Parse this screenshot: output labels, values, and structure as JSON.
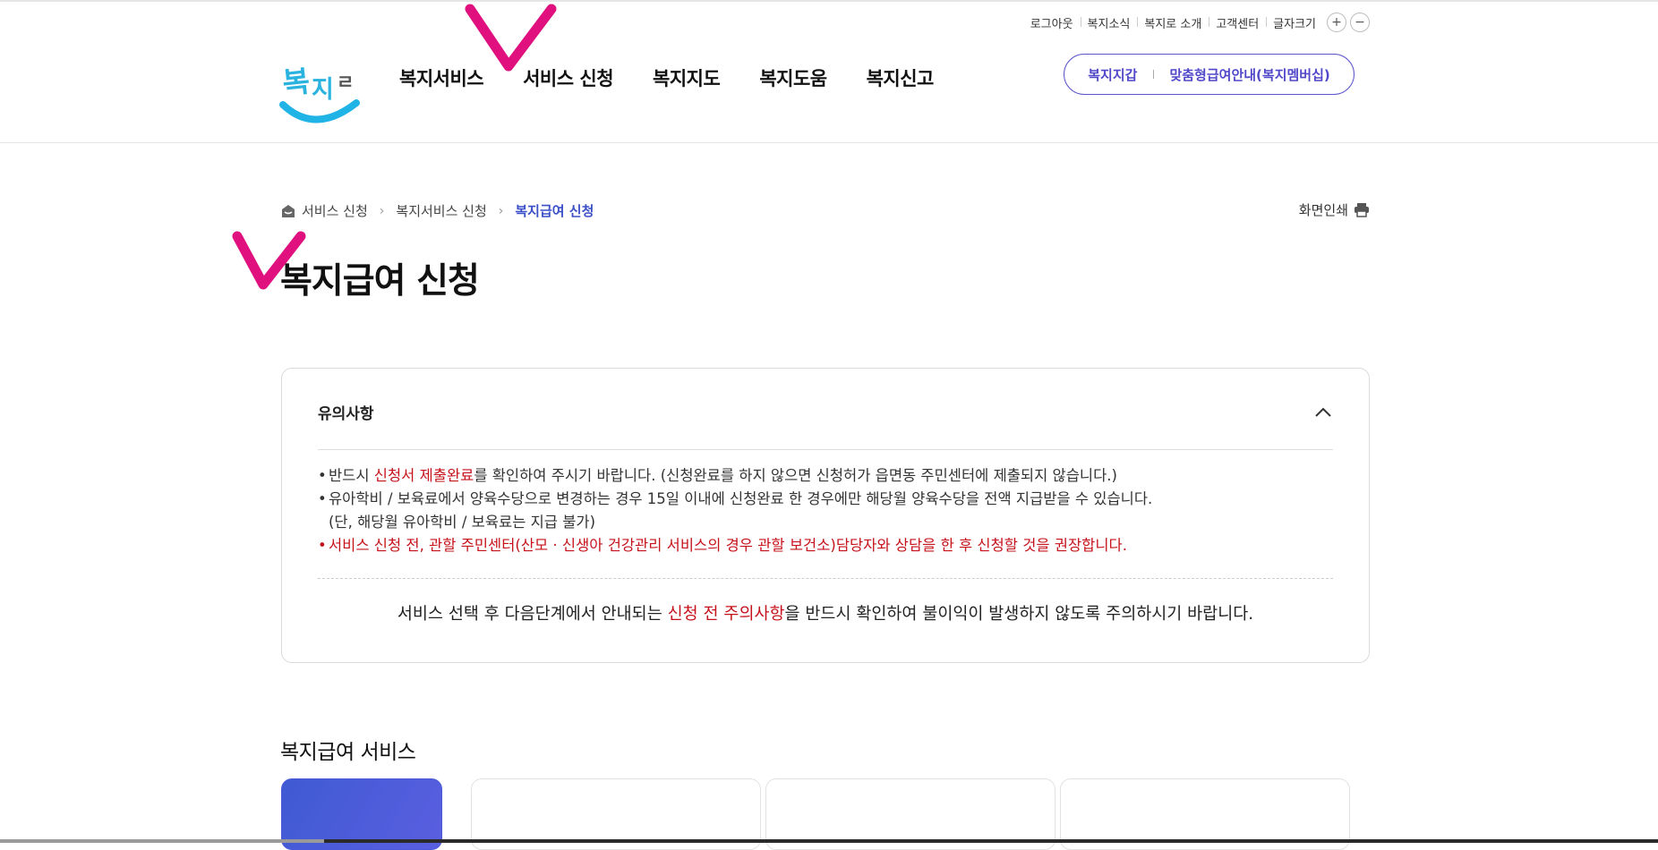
{
  "utility_menu": {
    "items": [
      "로그아웃",
      "복지소식",
      "복지로 소개",
      "고객센터"
    ],
    "font_size_label": "글자크기",
    "increase": "+",
    "decrease": "−"
  },
  "logo": {
    "text": "복지로"
  },
  "gnb": {
    "items": [
      "복지서비스",
      "서비스 신청",
      "복지지도",
      "복지도움",
      "복지신고"
    ]
  },
  "quick_links": {
    "items": [
      "복지지갑",
      "맞춤형급여안내(복지멤버십)"
    ]
  },
  "breadcrumb": {
    "items": [
      "서비스 신청",
      "복지서비스 신청",
      "복지급여 신청"
    ]
  },
  "print_label": "화면인쇄",
  "page_title": "복지급여 신청",
  "notice": {
    "title": "유의사항",
    "item1": {
      "before": "반드시 ",
      "highlight": "신청서 제출완료",
      "after": "를 확인하여 주시기 바랍니다. (신청완료를 하지 않으면 신청허가 읍면동 주민센터에 제출되지 않습니다.)"
    },
    "item2": {
      "line1": "유아학비 / 보육료에서 양육수당으로 변경하는 경우 15일 이내에 신청완료 한 경우에만 해당월 양육수당을 전액 지급받을 수 있습니다.",
      "line2": "(단, 해당월 유아학비 / 보육료는 지급 불가)"
    },
    "item3": "서비스 신청 전, 관할 주민센터(산모 · 신생아 건강관리 서비스의 경우 관할 보건소)담당자와 상담을 한 후 신청할 것을 권장합니다.",
    "footer": {
      "before": "서비스 선택 후 다음단계에서 안내되는 ",
      "highlight": "신청 전 주의사항",
      "after": "을 반드시 확인하여 불이익이 발생하지 않도록 주의하시기 바랍니다."
    }
  },
  "section": {
    "title": "복지급여 서비스"
  },
  "colors": {
    "accent": "#3b50c8",
    "warning": "#c6131b",
    "annotation": "#e0117f",
    "pill": "#5148c9"
  }
}
